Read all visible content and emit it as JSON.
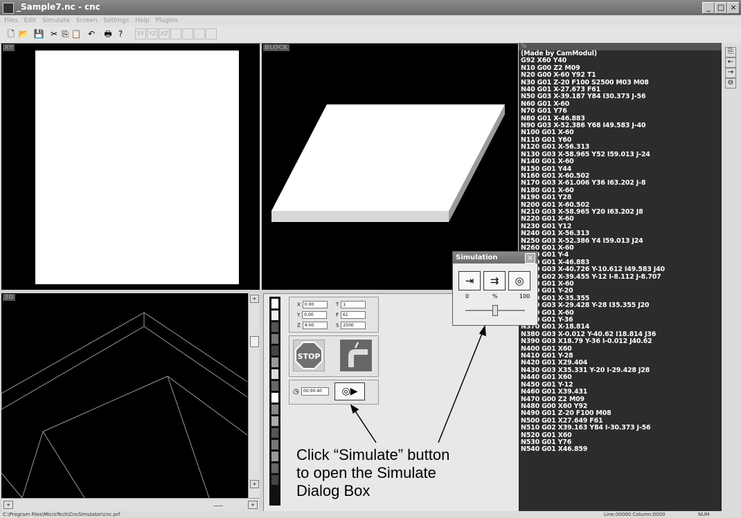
{
  "window": {
    "title": "_Sample7.nc - cnc",
    "minimize": "_",
    "maximize": "□",
    "close": "×"
  },
  "menu": [
    "Files",
    "Edit",
    "Simulate",
    "Screen",
    "Settings",
    "Help",
    "Plugins"
  ],
  "toolbar": {
    "axes": [
      "XY",
      "YZ",
      "XZ"
    ]
  },
  "panes": {
    "xy_label": "XY",
    "block_label": "BLOCK",
    "view3d_label": "3D"
  },
  "code": {
    "header": "%",
    "lines": [
      "(Made by CamModul)",
      "G92 X60 Y40",
      "N10 G00 Z2 M09",
      "N20 G00 X-60 Y92 T1",
      "N30 G01 Z-20 F100 S2500 M03 M08",
      "N40 G01 X-27.673 F61",
      "N50 G03 X-39.187 Y84 I30.373 J-56",
      "N60 G01 X-60",
      "N70 G01 Y76",
      "N80 G01 X-46.883",
      "N90 G03 X-52.386 Y68 I49.583 J-40",
      "N100 G01 X-60",
      "N110 G01 Y60",
      "N120 G01 X-56.313",
      "N130 G03 X-58.965 Y52 I59.013 J-24",
      "N140 G01 X-60",
      "N150 G01 Y44",
      "N160 G01 X-60.502",
      "N170 G03 X-61.006 Y36 I63.202 J-8",
      "N180 G01 X-60",
      "N190 G01 Y28",
      "N200 G01 X-60.502",
      "N210 G03 X-58.965 Y20 I63.202 J8",
      "N220 G01 X-60",
      "N230 G01 Y12",
      "N240 G01 X-56.313",
      "N250 G03 X-52.386 Y4 I59.013 J24",
      "N260 G01 X-60",
      "N270 G01 Y-4",
      "N280 G01 X-46.883",
      "N290 G03 X-40.726 Y-10.612 I49.583 J40",
      "N300 G02 X-39.455 Y-12 I-8.112 J-8.707",
      "N310 G01 X-60",
      "N320 G01 Y-20",
      "N330 G01 X-35.355",
      "N340 G03 X-29.428 Y-28 I35.355 J20",
      "N350 G01 X-60",
      "N360 G01 Y-36",
      "N370 G01 X-18.814",
      "N380 G03 X-0.012 Y-40.62 I18.814 J36",
      "N390 G03 X18.79 Y-36 I-0.012 J40.62",
      "N400 G01 X60",
      "N410 G01 Y-28",
      "N420 G01 X29.404",
      "N430 G03 X35.331 Y-20 I-29.428 J28",
      "N440 G01 X60",
      "N450 G01 Y-12",
      "N460 G01 X39.431",
      "N470 G00 Z2 M09",
      "N480 G00 X60 Y92",
      "N490 G01 Z-20 F100 M08",
      "N500 G01 X27.649 F61",
      "N510 G02 X39.163 Y84 I-30.373 J-56",
      "N520 G01 X60",
      "N530 G01 Y76",
      "N540 G01 X46.859"
    ]
  },
  "controls": {
    "x_label": "X",
    "x_value": "0.00",
    "y_label": "Y",
    "y_value": "0.00",
    "z_label": "Z",
    "z_value": "4.00",
    "t_label": "T",
    "t_value": "1",
    "f_label": "F",
    "f_value": "61",
    "s_label": "S",
    "s_value": "2500",
    "stop_label": "STOP",
    "timer_value": "00:00:40"
  },
  "simulation_dialog": {
    "title": "Simulation",
    "close": "×",
    "min_label": "0",
    "unit_label": "%",
    "max_label": "100",
    "speed_percent": 50
  },
  "statusbar": {
    "path": "C:\\Program Files\\MicroTech\\CncSimulator\\cnc.prf",
    "position": "Line:00000 Column:0000",
    "num": "NUM"
  },
  "annotation": {
    "line1": "Click “Simulate” button",
    "line2": "to open the Simulate",
    "line3": "Dialog Box"
  }
}
